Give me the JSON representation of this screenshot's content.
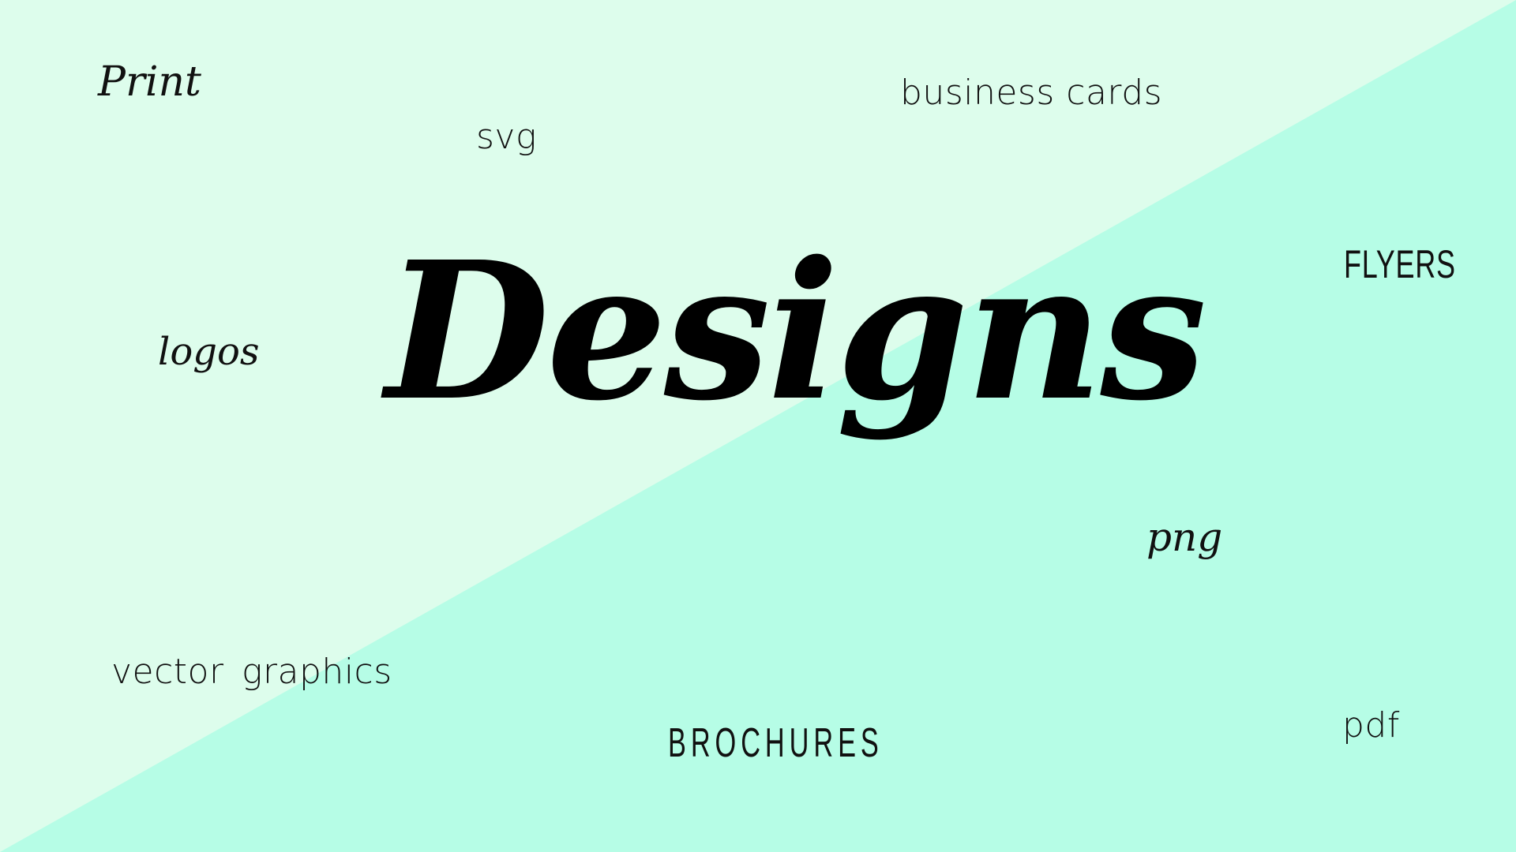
{
  "colors": {
    "background_top_left": "#ddfdec",
    "background_bottom_right": "#b6fde6",
    "text": "#111111"
  },
  "title": "Designs",
  "words": {
    "print": "Print",
    "svg": "svg",
    "business_cards": "business cards",
    "flyers": "Flyers",
    "logos": "logos",
    "png": "png",
    "vector_graphics": "vector  graphics",
    "brochures": "BROCHURES",
    "pdf": "pdf"
  }
}
